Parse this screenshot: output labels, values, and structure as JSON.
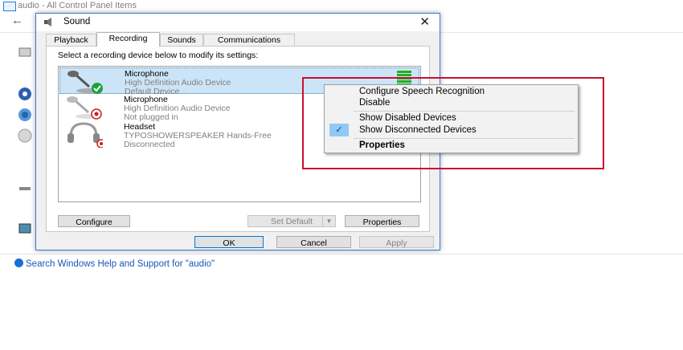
{
  "background_window": {
    "title": "audio - All Control Panel Items",
    "search_link": "Search Windows Help and Support for \"audio\""
  },
  "dialog": {
    "title": "Sound",
    "close_glyph": "✕",
    "tabs": [
      {
        "label": "Playback"
      },
      {
        "label": "Recording"
      },
      {
        "label": "Sounds"
      },
      {
        "label": "Communications"
      }
    ],
    "instruction": "Select a recording device below to modify its settings:",
    "devices": [
      {
        "name": "Microphone",
        "description": "High Definition Audio Device",
        "status": "Default Device",
        "icon": "microphone-icon"
      },
      {
        "name": "Microphone",
        "description": "High Definition Audio Device",
        "status": "Not plugged in",
        "icon": "microphone-icon"
      },
      {
        "name": "Headset",
        "description": "TYPOSHOWERSPEAKER Hands-Free",
        "status": "Disconnected",
        "icon": "headset-icon"
      }
    ],
    "buttons": {
      "configure": "Configure",
      "set_default": "Set Default",
      "properties": "Properties",
      "ok": "OK",
      "cancel": "Cancel",
      "apply": "Apply"
    }
  },
  "context_menu": {
    "items": [
      {
        "label": "Configure Speech Recognition"
      },
      {
        "label": "Disable"
      },
      {
        "label": "Show Disabled Devices"
      },
      {
        "label": "Show Disconnected Devices"
      },
      {
        "label": "Properties"
      }
    ],
    "check_glyph": "✓"
  },
  "colors": {
    "selection": "#cce4f7",
    "highlight_box": "#c8102e",
    "level_meter": "#20b020",
    "link": "#1a57b8"
  }
}
